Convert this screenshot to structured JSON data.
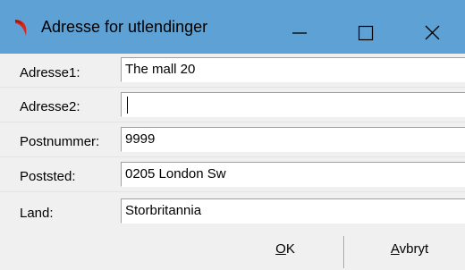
{
  "window": {
    "title": "Adresse for utlendinger",
    "icon": "red-curl-app-icon",
    "controls": {
      "minimize": "minimize-icon",
      "maximize": "maximize-icon",
      "close": "close-icon"
    },
    "title_bar_color": "#5ea1d4"
  },
  "form": {
    "adresse1": {
      "label": "Adresse1:",
      "value": "The mall 20"
    },
    "adresse2": {
      "label": "Adresse2:",
      "value": ""
    },
    "postnummer": {
      "label": "Postnummer:",
      "value": "9999"
    },
    "poststed": {
      "label": "Poststed:",
      "value": "0205 London Sw"
    },
    "land": {
      "label": "Land:",
      "value": "Storbritannia"
    }
  },
  "buttons": {
    "ok": {
      "mnemonic": "O",
      "rest": "K"
    },
    "cancel": {
      "mnemonic": "A",
      "rest": "vbryt"
    }
  }
}
